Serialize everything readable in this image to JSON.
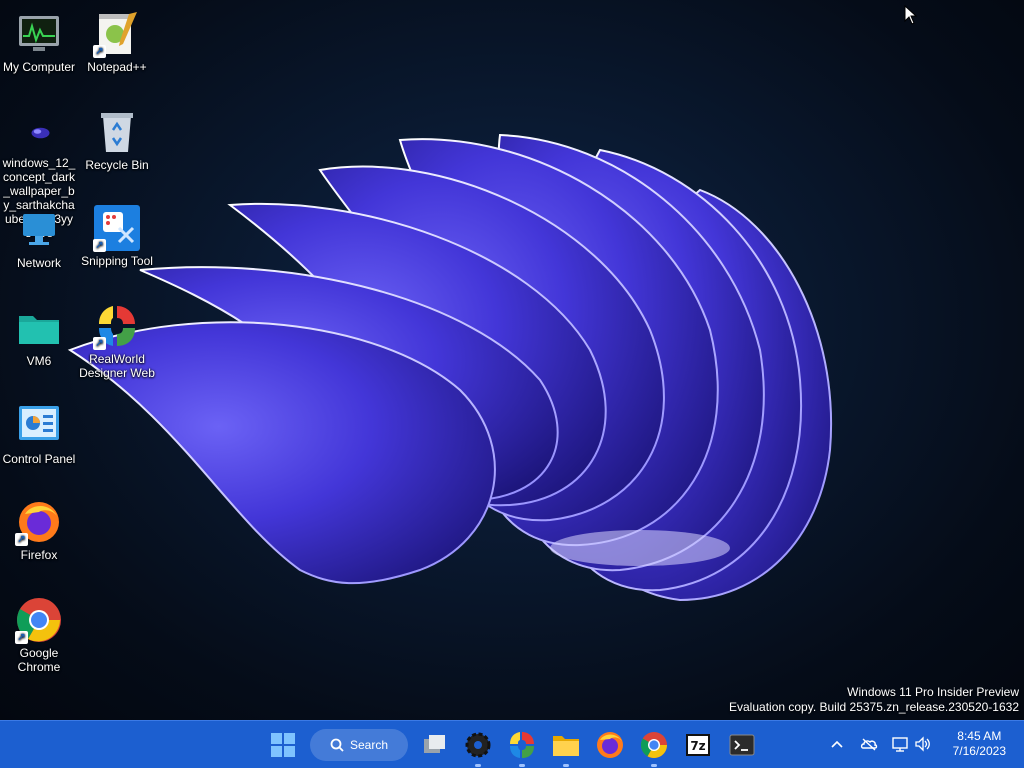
{
  "desktop": {
    "icons": [
      {
        "label": "My Computer"
      },
      {
        "label": "Notepad++"
      },
      {
        "label": "windows_12_concept_dark_wallpaper_by_sarthakchaubey_df53yy8-pre"
      },
      {
        "label": "Recycle Bin"
      },
      {
        "label": "Network"
      },
      {
        "label": "Snipping Tool"
      },
      {
        "label": "VM6"
      },
      {
        "label": "RealWorld Designer Web"
      },
      {
        "label": "Control Panel"
      },
      {
        "label": "Firefox"
      },
      {
        "label": "Google Chrome"
      }
    ]
  },
  "watermark": {
    "line1": "Windows 11 Pro Insider Preview",
    "line2": "Evaluation copy. Build 25375.zn_release.230520-1632"
  },
  "taskbar": {
    "search_label": "Search",
    "pinned": [
      "start-icon",
      "task-view-icon",
      "settings-icon",
      "realworld-icon",
      "file-explorer-icon",
      "firefox-icon",
      "chrome-icon",
      "7zip-icon",
      "terminal-icon"
    ],
    "tray": [
      "chevron-up-icon",
      "onedrive-icon",
      "network-icon",
      "volume-icon"
    ],
    "time": "8:45 AM",
    "date": "7/16/2023"
  },
  "colors": {
    "taskbar": "#1c5fd0",
    "accent": "#4a3fe0"
  }
}
